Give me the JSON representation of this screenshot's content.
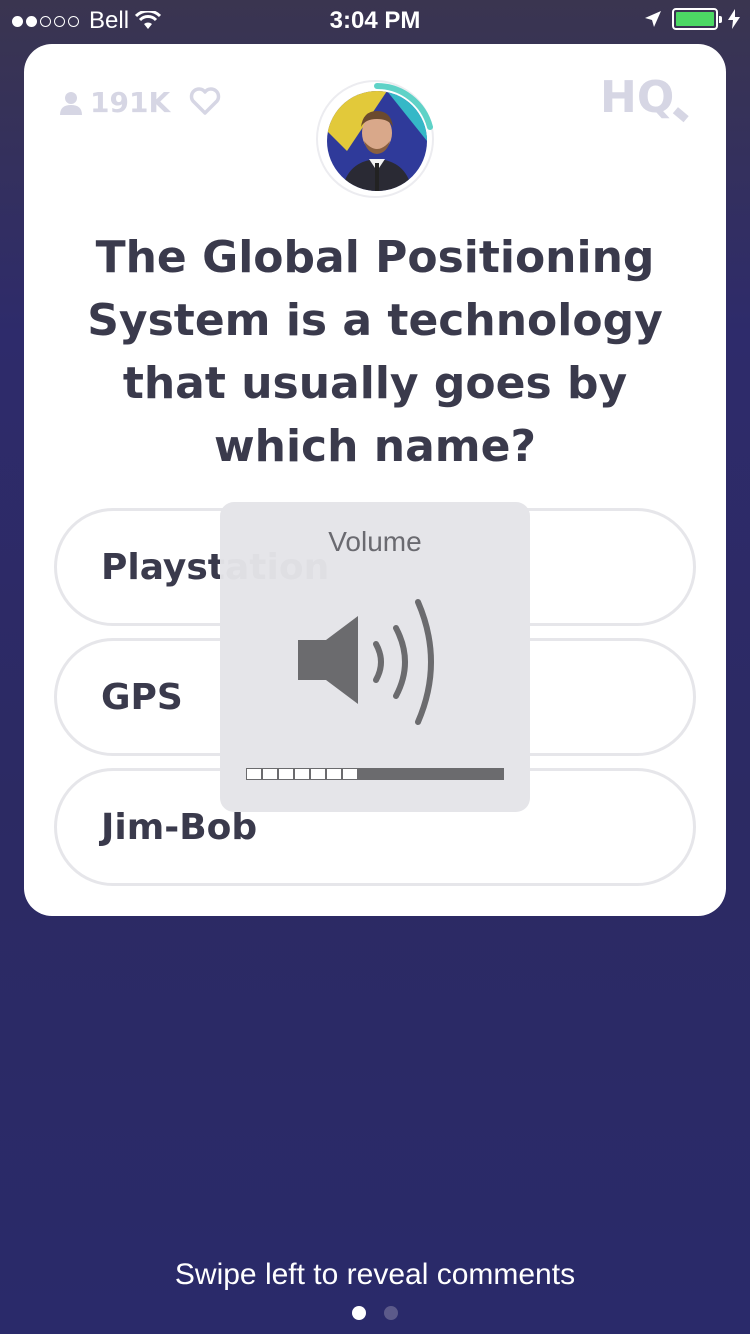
{
  "status_bar": {
    "carrier": "Bell",
    "time": "3:04 PM",
    "battery_color": "#4cd964",
    "signal_bars_filled": 2,
    "signal_bars_total": 5
  },
  "game": {
    "viewer_count": "191K",
    "logo_text": "HQ",
    "question": "The Global Positioning System is a technology that usually goes by which name?",
    "answers": [
      {
        "label": "Playstation"
      },
      {
        "label": "GPS"
      },
      {
        "label": "Jim-Bob"
      }
    ]
  },
  "volume_hud": {
    "title": "Volume",
    "level_fraction": 0.44
  },
  "footer": {
    "hint": "Swipe left to reveal comments",
    "pages_total": 2,
    "active_page": 1
  },
  "colors": {
    "accent": "#5fd2c7",
    "text_dark": "#3a3a4c",
    "muted": "#d6d6e4"
  }
}
